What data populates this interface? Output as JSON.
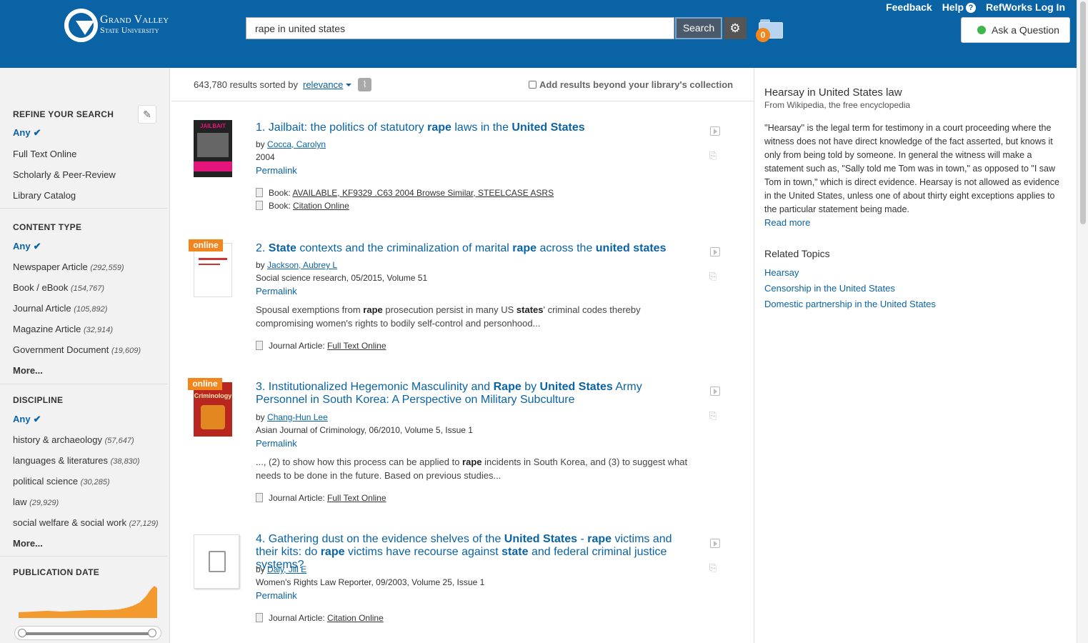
{
  "header": {
    "logo_line1": "Grand Valley",
    "logo_line2": "State University",
    "search_value": "rape in united states",
    "search_button": "Search",
    "folder_count": "0",
    "links": {
      "feedback": "Feedback",
      "help": "Help",
      "help_glyph": "?",
      "refworks": "RefWorks Log In"
    },
    "ask_question": "Ask a Question"
  },
  "results_bar": {
    "count": "643,780 results sorted by",
    "sort": "relevance",
    "beyond": "Add results beyond your library's collection"
  },
  "sidebar": {
    "refine": {
      "title": "REFINE YOUR SEARCH",
      "any": "Any",
      "items": [
        "Full Text Online",
        "Scholarly & Peer-Review",
        "Library Catalog"
      ]
    },
    "content_type": {
      "title": "CONTENT TYPE",
      "any": "Any",
      "items": [
        {
          "label": "Newspaper Article",
          "count": "(292,559)"
        },
        {
          "label": "Book / eBook",
          "count": "(154,767)"
        },
        {
          "label": "Journal Article",
          "count": "(105,892)"
        },
        {
          "label": "Magazine Article",
          "count": "(32,914)"
        },
        {
          "label": "Government Document",
          "count": "(19,609)"
        }
      ],
      "more": "More..."
    },
    "discipline": {
      "title": "DISCIPLINE",
      "any": "Any",
      "items": [
        {
          "label": "history & archaeology",
          "count": "(57,647)"
        },
        {
          "label": "languages & literatures",
          "count": "(38,830)"
        },
        {
          "label": "political science",
          "count": "(30,285)"
        },
        {
          "label": "law",
          "count": "(29,929)"
        },
        {
          "label": "social welfare & social work",
          "count": "(27,129)"
        }
      ],
      "more": "More..."
    },
    "pub_date": {
      "title": "PUBLICATION DATE"
    }
  },
  "results": [
    {
      "num": "1.",
      "title_parts": [
        {
          "t": "Jailbait: the politics of statutory ",
          "b": false
        },
        {
          "t": "rape",
          "b": true
        },
        {
          "t": " laws in the ",
          "b": false
        },
        {
          "t": "United States",
          "b": true
        }
      ],
      "by": "by",
      "author": "Cocca, Carolyn",
      "source": "2004",
      "permalink": "Permalink",
      "thumb_text": "JAILBAIT",
      "formats": [
        {
          "type": "Book:",
          "link": "AVAILABLE, KF9329 .C63 2004 Browse Similar, STEELCASE ASRS"
        },
        {
          "type": "Book:",
          "link": "Citation Online"
        }
      ]
    },
    {
      "num": "2.",
      "title_parts": [
        {
          "t": "State",
          "b": true
        },
        {
          "t": " contexts and the criminalization of marital ",
          "b": false
        },
        {
          "t": "rape",
          "b": true
        },
        {
          "t": " across the ",
          "b": false
        },
        {
          "t": "united states",
          "b": true
        }
      ],
      "by": "by",
      "author": "Jackson, Aubrey L",
      "source": "Social science research, 05/2015, Volume 51",
      "permalink": "Permalink",
      "online": "online",
      "snippet_parts": [
        {
          "t": "Spousal exemptions from ",
          "b": false
        },
        {
          "t": "rape",
          "b": true
        },
        {
          "t": " prosecution persist in many US ",
          "b": false
        },
        {
          "t": "states",
          "b": true
        },
        {
          "t": "' criminal codes thereby compromising women's rights to bodily self-control and personhood...",
          "b": false
        }
      ],
      "formats": [
        {
          "type": "Journal Article:",
          "link": "Full Text Online"
        }
      ]
    },
    {
      "num": "3.",
      "title_parts": [
        {
          "t": "Institutionalized Hegemonic Masculinity and ",
          "b": false
        },
        {
          "t": "Rape",
          "b": true
        },
        {
          "t": " by ",
          "b": false
        },
        {
          "t": "United States",
          "b": true
        },
        {
          "t": " Army Personnel in South Korea: A Perspective on Military Subculture",
          "b": false
        }
      ],
      "by": "by",
      "author": "Chang-Hun Lee",
      "source": "Asian Journal of Criminology, 06/2010, Volume 5, Issue 1",
      "permalink": "Permalink",
      "online": "online",
      "thumb_text": "Criminology",
      "snippet_parts": [
        {
          "t": "..., (2) to show how this process can be applied to ",
          "b": false
        },
        {
          "t": "rape",
          "b": true
        },
        {
          "t": " incidents in South Korea, and (3) to suggest what needs to be done in the future. Based on previous studies...",
          "b": false
        }
      ],
      "formats": [
        {
          "type": "Journal Article:",
          "link": "Full Text Online"
        }
      ]
    },
    {
      "num": "4.",
      "title_parts": [
        {
          "t": "Gathering dust on the evidence shelves of the ",
          "b": false
        },
        {
          "t": "United States",
          "b": true
        },
        {
          "t": " - ",
          "b": false
        },
        {
          "t": "rape",
          "b": true
        },
        {
          "t": " victims and their kits: do ",
          "b": false
        },
        {
          "t": "rape",
          "b": true
        },
        {
          "t": " victims have recourse against ",
          "b": false
        },
        {
          "t": "state",
          "b": true
        },
        {
          "t": " and federal criminal justice systems?",
          "b": false
        }
      ],
      "by": "by",
      "author": "Daly, Jill E",
      "source": "Women's Rights Law Reporter, 09/2003, Volume 25, Issue 1",
      "permalink": "Permalink",
      "formats": [
        {
          "type": "Journal Article:",
          "link": "Citation Online"
        }
      ]
    }
  ],
  "right_panel": {
    "title": "Hearsay in United States law",
    "subtitle": "From Wikipedia, the free encyclopedia",
    "body": "''Hearsay'' is the legal term for testimony in a court proceeding where the witness does not have direct knowledge of the fact asserted, but knows it only from being told by someone. In general the witness will make a statement such as, \"Sally told me Tom was in town,\" as opposed to \"I saw Tom in town,\" which is direct evidence. Hearsay is not allowed as evidence in the United States, unless one of about thirty eight exceptions applies to the particular statement being made.",
    "read_more": "Read more",
    "related_title": "Related Topics",
    "topics": [
      "Hearsay",
      "Censorship in the United States",
      "Domestic partnership in the United States"
    ]
  },
  "colors": {
    "brand": "#0a63a5",
    "accent": "#f0861d",
    "online_green": "#3fb64a",
    "histogram": "#f29a2e"
  }
}
